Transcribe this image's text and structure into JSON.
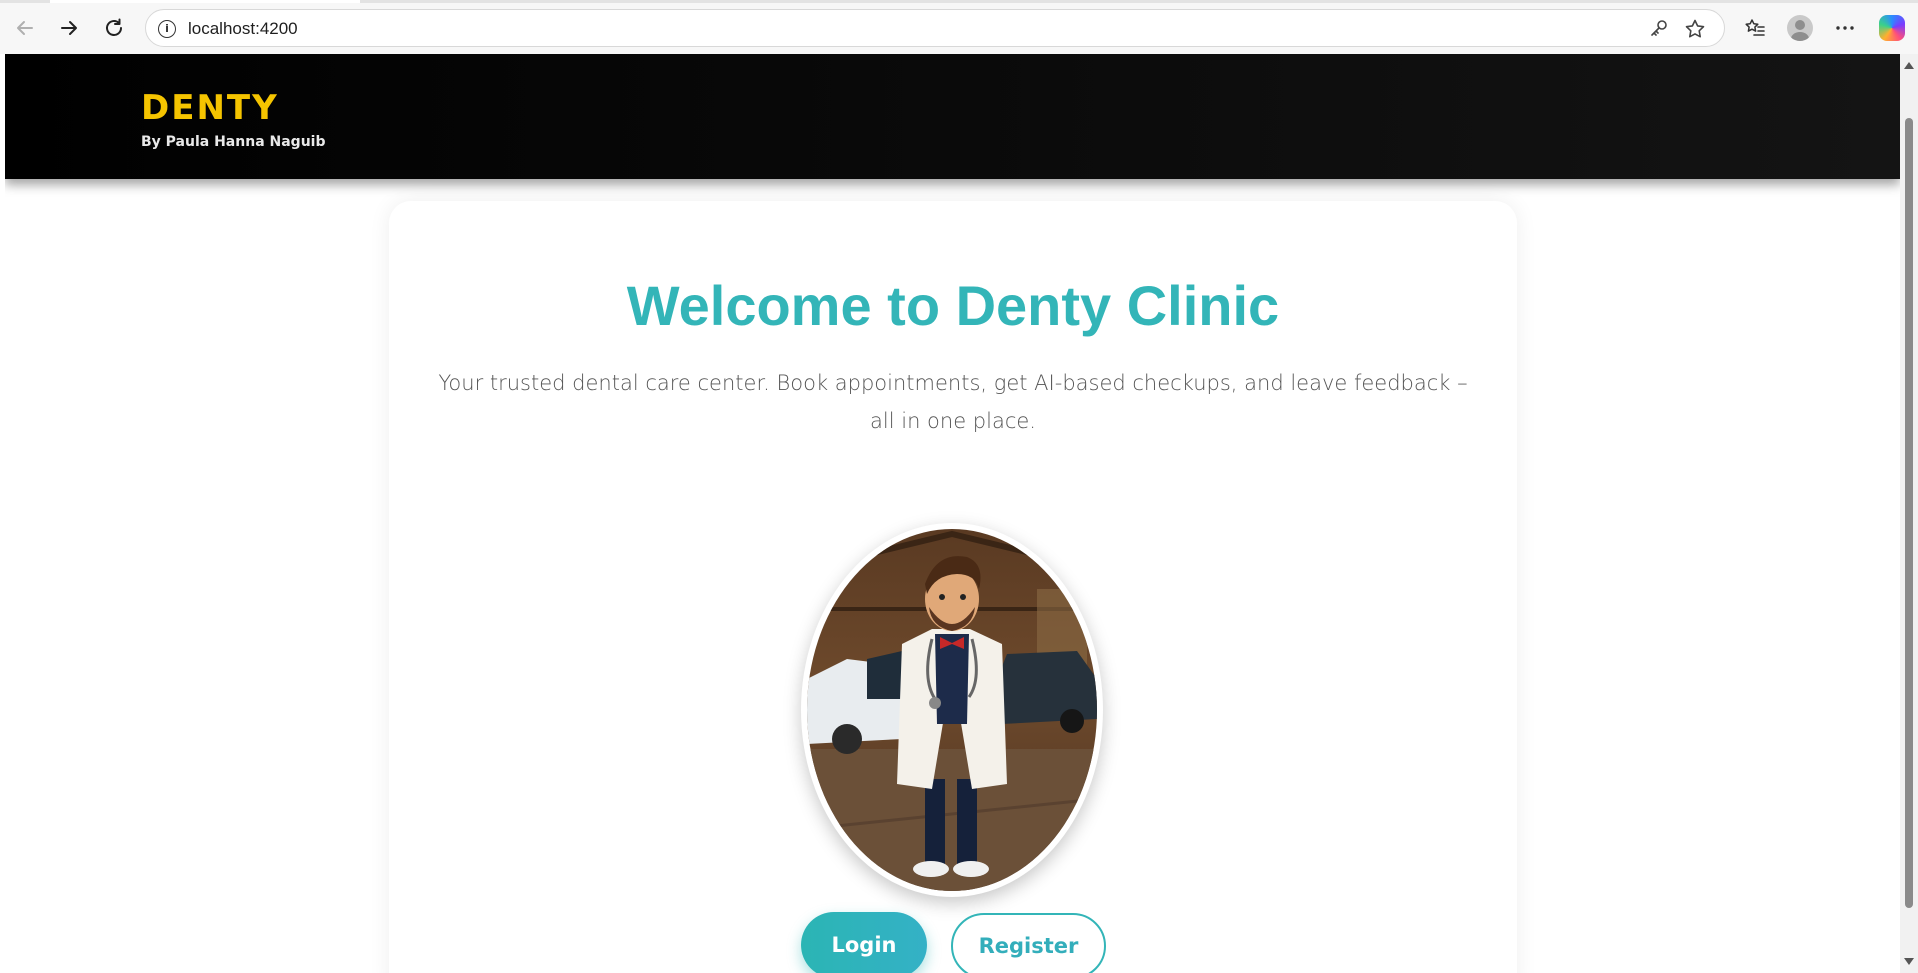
{
  "browser": {
    "url": "localhost:4200",
    "icons": {
      "back": "back-arrow-icon",
      "forward": "forward-arrow-icon",
      "reload": "reload-icon",
      "site_info": "info-icon",
      "password": "key-icon",
      "favorite": "star-icon",
      "favorites": "favorites-list-icon",
      "profile": "profile-avatar",
      "more": "more-dots-icon",
      "copilot": "copilot-icon"
    }
  },
  "header": {
    "brand": "DENTY",
    "subtitle": "By Paula Hanna Naguib"
  },
  "hero": {
    "title": "Welcome to Denty Clinic",
    "description": "Your trusted dental care center. Book appointments, get AI-based checkups, and leave feedback – all in one place.",
    "image": "doctor-cartoon-illustration"
  },
  "actions": {
    "login_label": "Login",
    "register_label": "Register"
  },
  "colors": {
    "brand": "#f5c400",
    "accent": "#33b5b8",
    "header_bg": "#000000"
  }
}
